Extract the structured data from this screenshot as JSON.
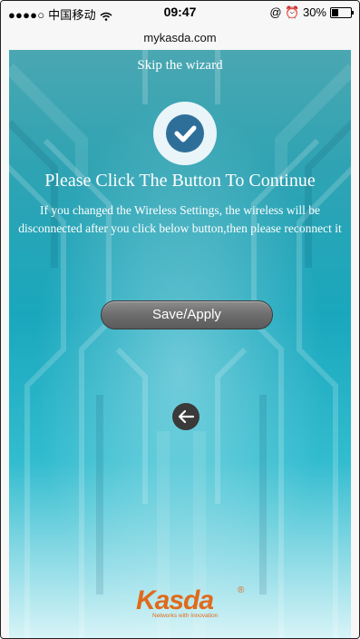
{
  "status_bar": {
    "carrier": "●●●●○ 中国移动",
    "wifi_icon": "wifi-icon",
    "time": "09:47",
    "right_text": "@ ⏰ 30%",
    "battery_level": 0.3
  },
  "browser": {
    "url": "mykasda.com"
  },
  "wizard": {
    "skip_label": "Skip the wizard",
    "title": "Please Click The Button To Continue",
    "description": "If you changed the Wireless Settings, the wireless will be disconnected after you click below button,then please reconnect it",
    "save_label": "Save/Apply",
    "back_icon": "arrow-left-icon",
    "check_icon": "checkmark-icon"
  },
  "logo": {
    "brand": "Kasda",
    "registered": "®",
    "tagline": "Networks with Innovation",
    "brand_color": "#e06a1c"
  },
  "colors": {
    "accent_teal": "#1aa7bd",
    "button_gray": "#6d6d6d",
    "badge_blue": "#2e6f9a"
  }
}
